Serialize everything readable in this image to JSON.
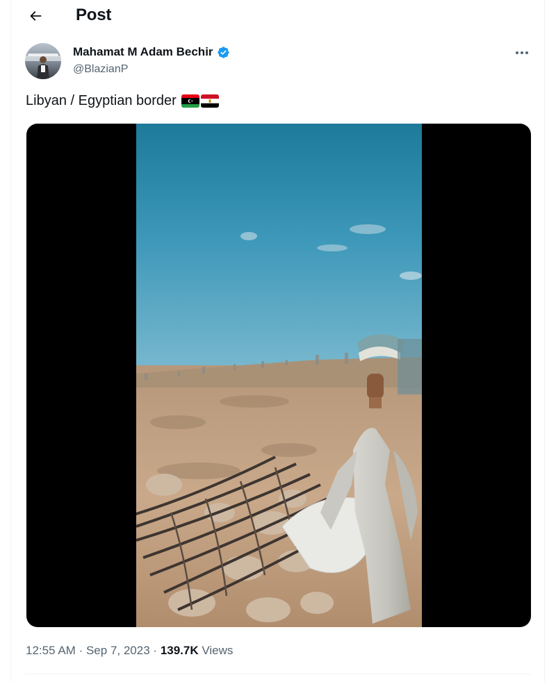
{
  "header": {
    "title": "Post",
    "back_icon": "arrow-left-icon"
  },
  "author": {
    "name": "Mahamat M Adam Bechir",
    "handle": "@BlazianP",
    "verified": true,
    "verified_color": "#1d9bf0"
  },
  "post": {
    "text": "Libyan / Egyptian border",
    "flags": [
      "libya-flag-icon",
      "egypt-flag-icon"
    ],
    "media_type": "video"
  },
  "meta": {
    "time": "12:55 AM",
    "separator": "·",
    "date": "Sep 7, 2023",
    "views_count": "139.7K",
    "views_label": "Views"
  },
  "colors": {
    "text_primary": "#0f1419",
    "text_secondary": "#536471",
    "accent": "#1d9bf0",
    "border": "#eff3f4"
  }
}
